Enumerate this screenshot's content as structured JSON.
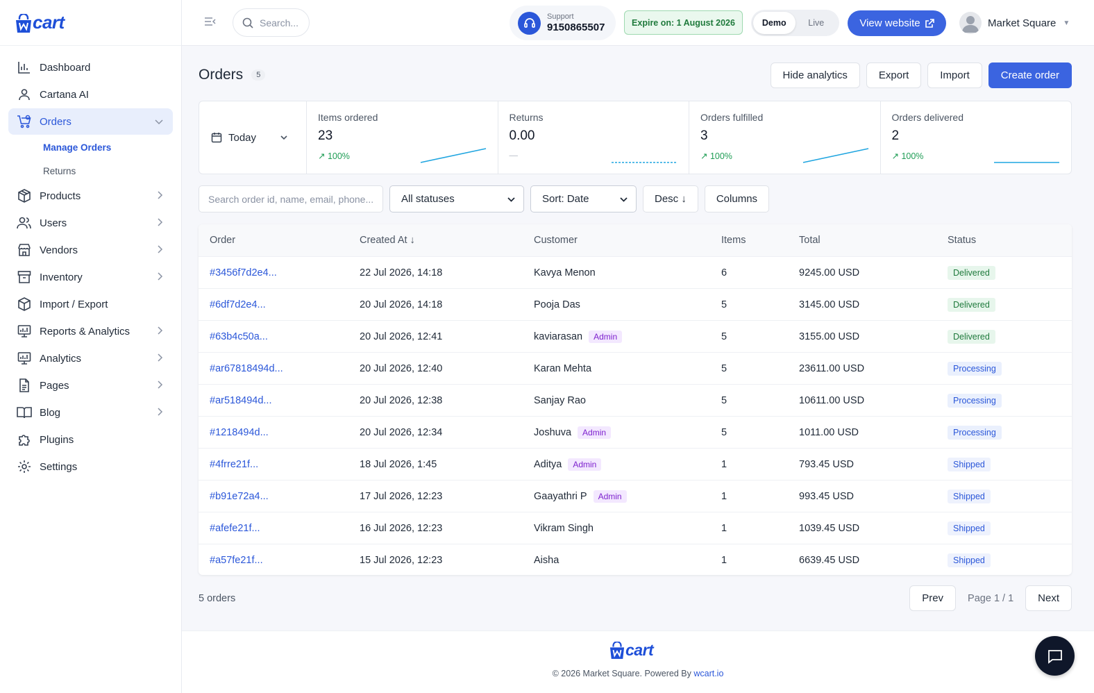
{
  "brand": {
    "name": "cart",
    "footer_name": "cart"
  },
  "sidebar": {
    "items": [
      {
        "label": "Dashboard",
        "icon": "bar-chart-icon"
      },
      {
        "label": "Cartana AI",
        "icon": "user-icon"
      },
      {
        "label": "Orders",
        "icon": "cart-icon",
        "active": true,
        "expanded": true
      },
      {
        "label": "Products",
        "icon": "box-icon"
      },
      {
        "label": "Users",
        "icon": "users-icon"
      },
      {
        "label": "Vendors",
        "icon": "store-icon"
      },
      {
        "label": "Inventory",
        "icon": "archive-icon"
      },
      {
        "label": "Import / Export",
        "icon": "package-icon"
      },
      {
        "label": "Reports & Analytics",
        "icon": "monitor-chart-icon"
      },
      {
        "label": "Analytics",
        "icon": "monitor-chart-icon"
      },
      {
        "label": "Pages",
        "icon": "document-icon"
      },
      {
        "label": "Blog",
        "icon": "book-icon"
      },
      {
        "label": "Plugins",
        "icon": "puzzle-icon"
      },
      {
        "label": "Settings",
        "icon": "gear-icon"
      }
    ],
    "sub_items": [
      {
        "label": "Manage Orders",
        "active": true
      },
      {
        "label": "Returns"
      }
    ]
  },
  "header": {
    "search_placeholder": "Search...",
    "support_label": "Support",
    "support_number": "9150865507",
    "expire_text": "Expire on: 1 August 2026",
    "mode_demo": "Demo",
    "mode_live": "Live",
    "view_website": "View website",
    "profile_name": "Market Square"
  },
  "page": {
    "title": "Orders",
    "count": "5",
    "actions": {
      "hide_analytics": "Hide analytics",
      "export": "Export",
      "import": "Import",
      "create": "Create order"
    }
  },
  "stats": {
    "range": "Today",
    "cards": [
      {
        "label": "Items ordered",
        "value": "23",
        "change": "↗ 100%"
      },
      {
        "label": "Returns",
        "value": "0.00",
        "change": "—"
      },
      {
        "label": "Orders fulfilled",
        "value": "3",
        "change": "↗ 100%"
      },
      {
        "label": "Orders delivered",
        "value": "2",
        "change": "↗ 100%"
      }
    ]
  },
  "filters": {
    "search_placeholder": "Search order id, name, email, phone...",
    "status": "All statuses",
    "sort": "Sort: Date",
    "order": "Desc ↓",
    "columns": "Columns"
  },
  "table": {
    "headers": [
      "Order",
      "Created At ↓",
      "Customer",
      "Items",
      "Total",
      "Status"
    ],
    "admin_label": "Admin",
    "rows": [
      {
        "order": "#3456f7d2e4...",
        "created": "22 Jul 2026, 14:18",
        "customer": "Kavya Menon",
        "admin": false,
        "items": "6",
        "total": "9245.00 USD",
        "status": "Delivered"
      },
      {
        "order": "#6df7d2e4...",
        "created": "20 Jul 2026, 14:18",
        "customer": "Pooja Das",
        "admin": false,
        "items": "5",
        "total": "3145.00 USD",
        "status": "Delivered"
      },
      {
        "order": "#63b4c50a...",
        "created": "20 Jul 2026, 12:41",
        "customer": "kaviarasan",
        "admin": true,
        "items": "5",
        "total": "3155.00 USD",
        "status": "Delivered"
      },
      {
        "order": "#ar67818494d...",
        "created": "20 Jul 2026, 12:40",
        "customer": "Karan Mehta",
        "admin": false,
        "items": "5",
        "total": "23611.00 USD",
        "status": "Processing"
      },
      {
        "order": "#ar518494d...",
        "created": "20 Jul 2026, 12:38",
        "customer": "Sanjay Rao",
        "admin": false,
        "items": "5",
        "total": "10611.00 USD",
        "status": "Processing"
      },
      {
        "order": "#1218494d...",
        "created": "20 Jul 2026, 12:34",
        "customer": "Joshuva",
        "admin": true,
        "items": "5",
        "total": "1011.00 USD",
        "status": "Processing"
      },
      {
        "order": "#4frre21f...",
        "created": "18 Jul 2026, 1:45",
        "customer": "Aditya",
        "admin": true,
        "items": "1",
        "total": "793.45 USD",
        "status": "Shipped"
      },
      {
        "order": "#b91e72a4...",
        "created": "17 Jul 2026, 12:23",
        "customer": "Gaayathri P",
        "admin": true,
        "items": "1",
        "total": "993.45 USD",
        "status": "Shipped"
      },
      {
        "order": "#afefe21f...",
        "created": "16 Jul 2026, 12:23",
        "customer": "Vikram Singh",
        "admin": false,
        "items": "1",
        "total": "1039.45 USD",
        "status": "Shipped"
      },
      {
        "order": "#a57fe21f...",
        "created": "15 Jul 2026, 12:23",
        "customer": "Aisha",
        "admin": false,
        "items": "1",
        "total": "6639.45 USD",
        "status": "Shipped"
      }
    ]
  },
  "footer_bar": {
    "count": "5 orders",
    "prev": "Prev",
    "page_info": "Page 1 / 1",
    "next": "Next"
  },
  "footer": {
    "copyright": "© 2026 Market Square. Powered By ",
    "link": "wcart.io"
  },
  "colors": {
    "accent": "#3b64e0",
    "delivered": "#1f7a3c",
    "processing": "#2b57d9",
    "admin": "#7e22ce"
  }
}
